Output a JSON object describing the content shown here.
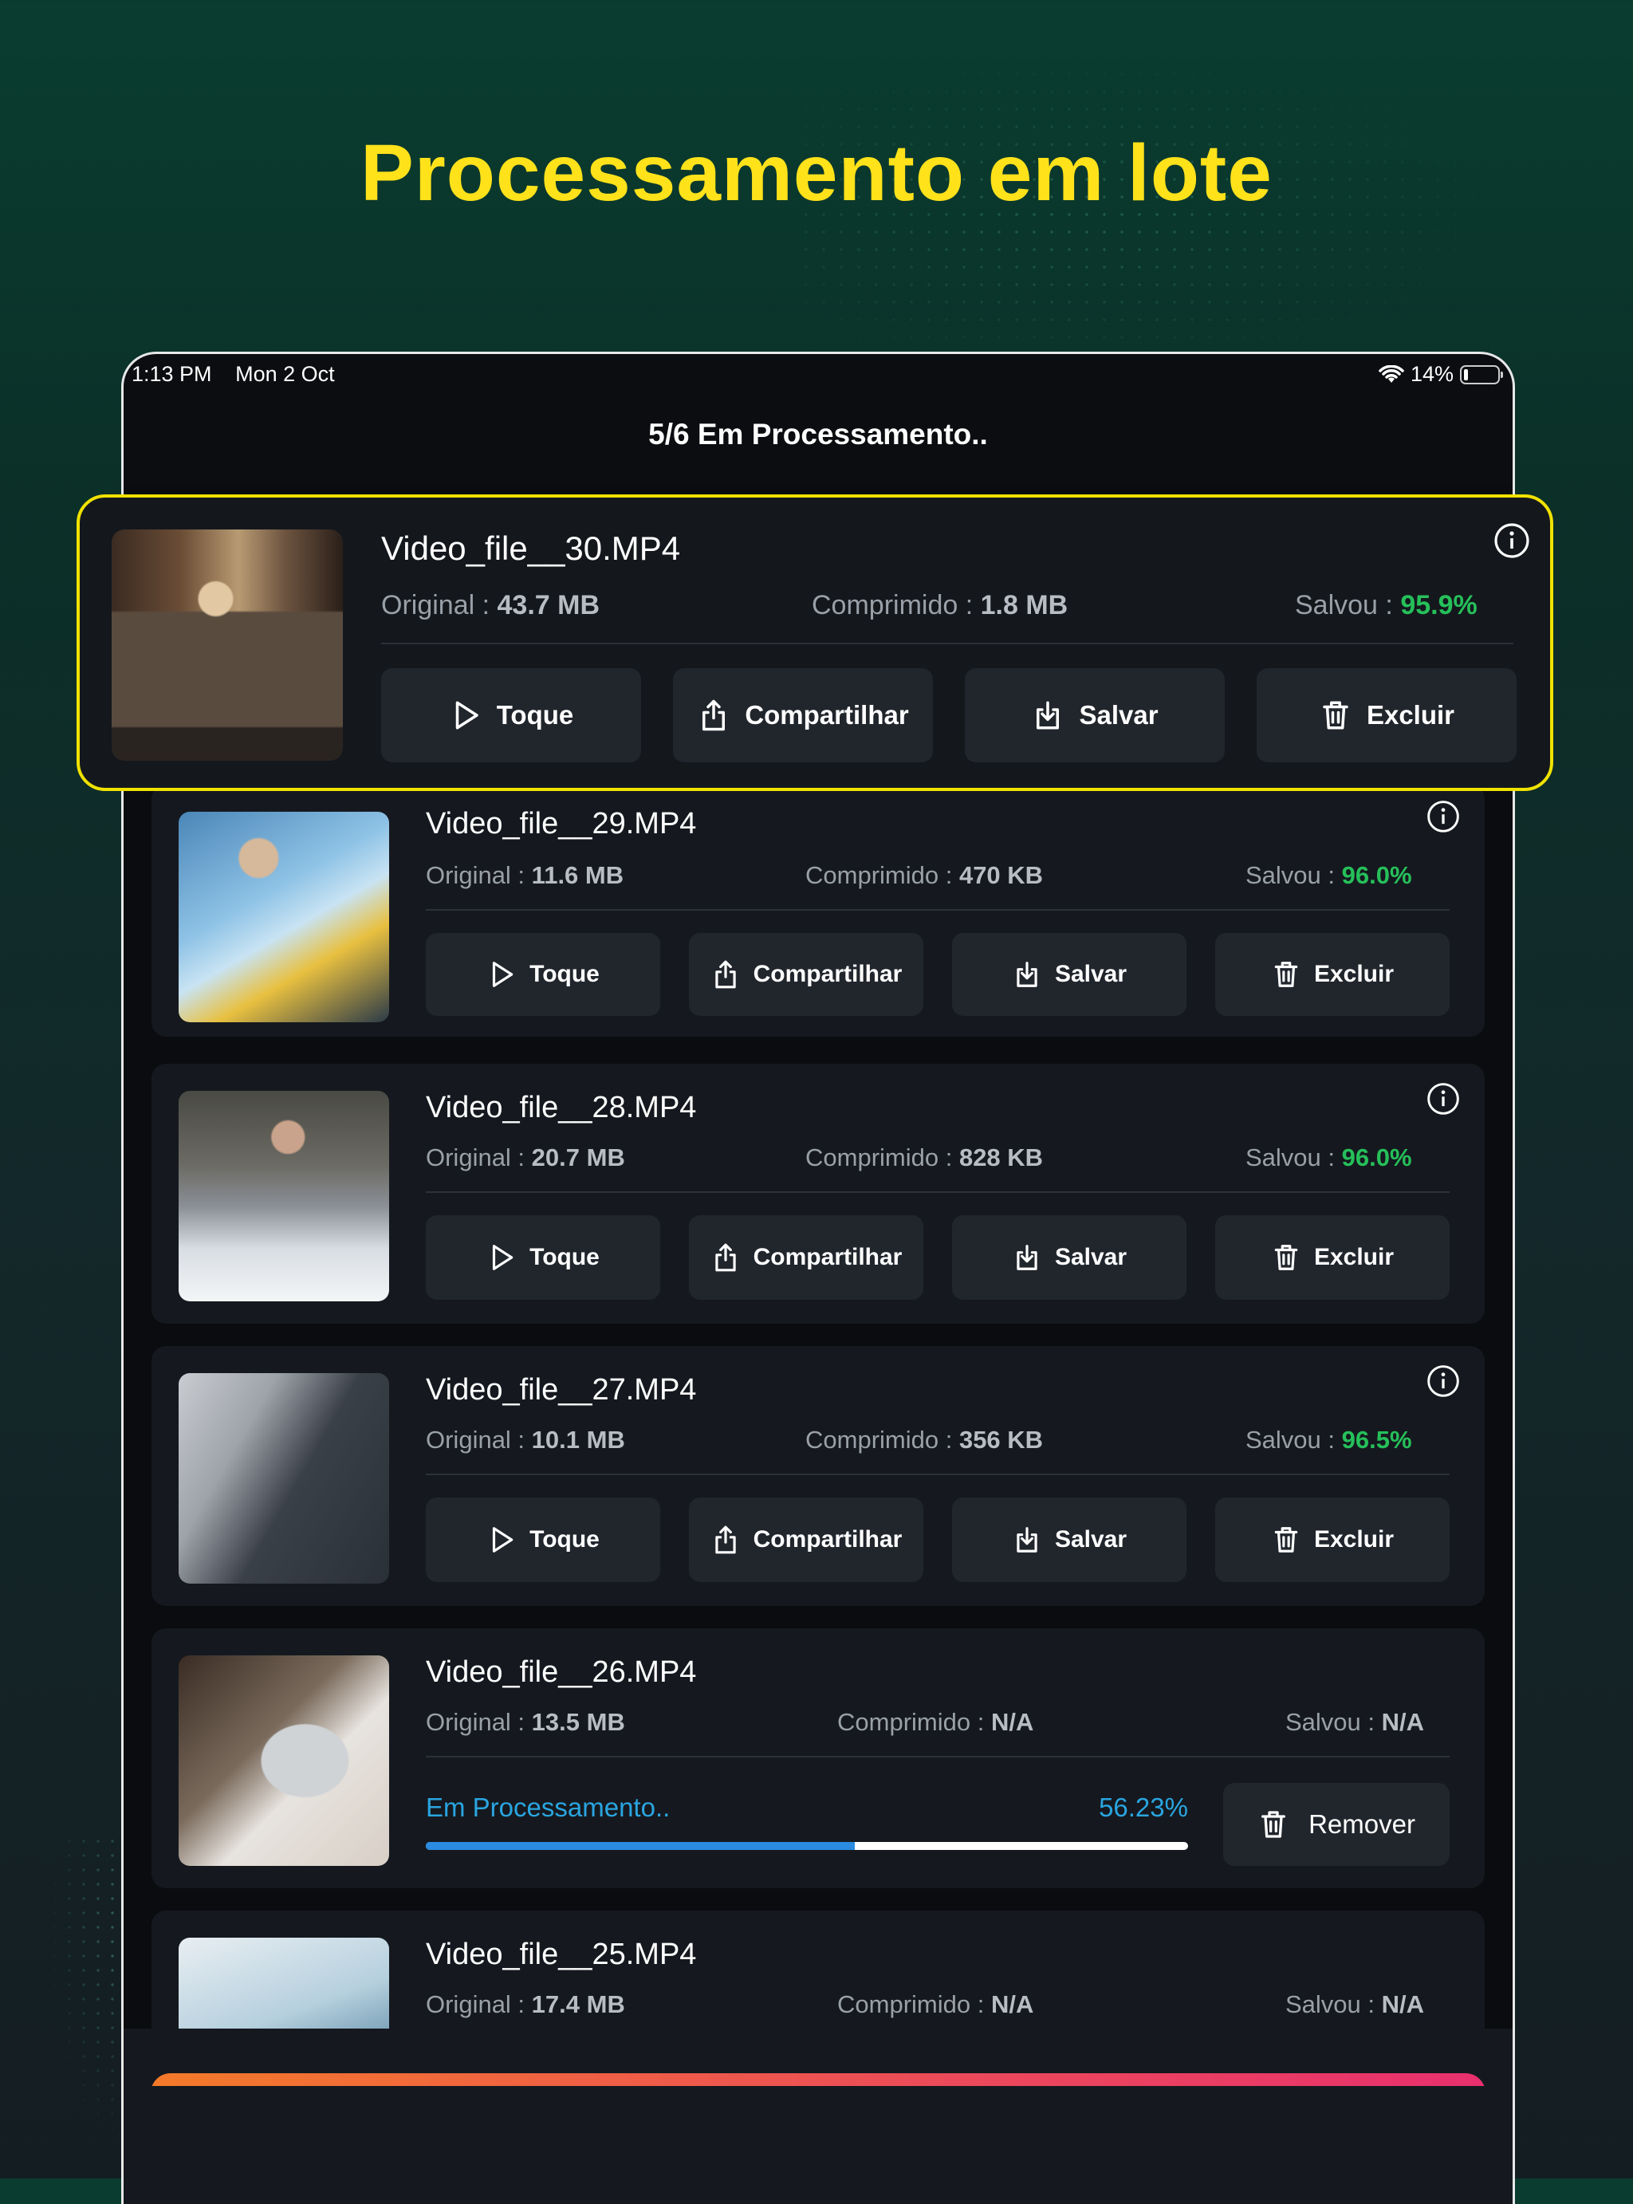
{
  "headline": "Processamento em lote",
  "status_bar": {
    "time": "1:13 PM",
    "date": "Mon 2 Oct",
    "battery": "14%"
  },
  "nav_title": "5/6 Em Processamento..",
  "labels": {
    "original": "Original :",
    "compressed": "Comprimido :",
    "saved": "Salvou :",
    "play": "Toque",
    "share": "Compartilhar",
    "save": "Salvar",
    "delete": "Excluir",
    "remove": "Remover",
    "processing": "Em Processamento.."
  },
  "highlighted_item": {
    "name": "Video_file__30.MP4",
    "original": "43.7 MB",
    "compressed": "1.8 MB",
    "saved": "95.9%"
  },
  "items": [
    {
      "name": "Video_file__29.MP4",
      "original": "11.6 MB",
      "compressed": "470 KB",
      "saved": "96.0%"
    },
    {
      "name": "Video_file__28.MP4",
      "original": "20.7 MB",
      "compressed": "828 KB",
      "saved": "96.0%"
    },
    {
      "name": "Video_file__27.MP4",
      "original": "10.1 MB",
      "compressed": "356 KB",
      "saved": "96.5%"
    },
    {
      "name": "Video_file__26.MP4",
      "original": "13.5 MB",
      "compressed": "N/A",
      "saved": "N/A",
      "progress_label": "56.23%",
      "progress": 0.5623
    },
    {
      "name": "Video_file__25.MP4",
      "original": "17.4 MB",
      "compressed": "N/A",
      "saved": "N/A"
    }
  ],
  "colors": {
    "accent_yellow": "#ffe21a",
    "saved_green": "#26c05a",
    "progress_blue": "#2a8be0"
  }
}
